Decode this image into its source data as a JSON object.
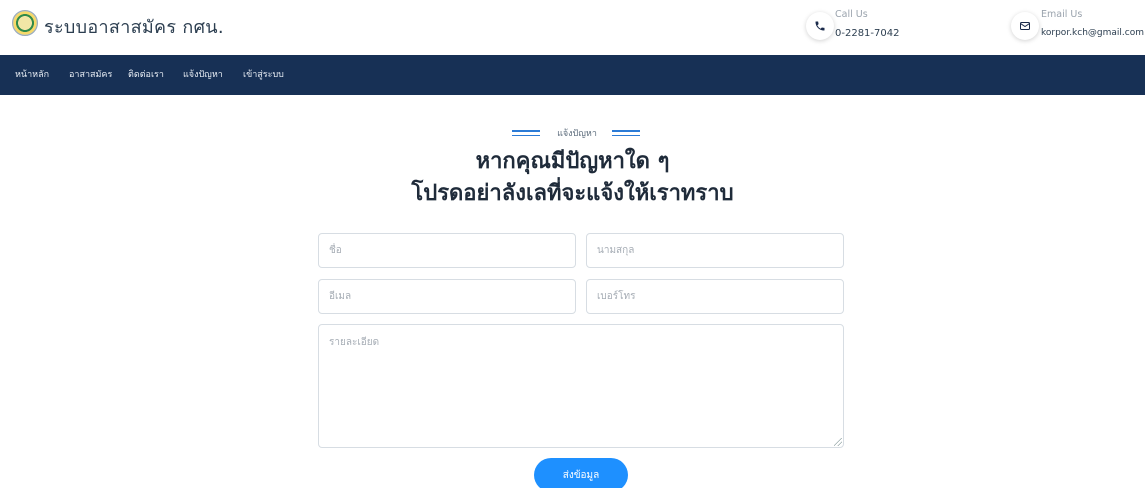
{
  "header": {
    "logo_text": "ระบบอาสาสมัคร กศน.",
    "phone": {
      "label": "Call Us",
      "value": "0-2281-7042",
      "icon": "phone-icon"
    },
    "email": {
      "label": "Email Us",
      "value": "korpor.kch@gmail.com",
      "icon": "mail-icon"
    }
  },
  "nav": {
    "items": [
      {
        "label": "หน้าหลัก"
      },
      {
        "label": "อาสาสมัคร"
      },
      {
        "label": "ติดต่อเรา"
      },
      {
        "label": "แจ้งปัญหา"
      },
      {
        "label": "เข้าสู่ระบบ"
      }
    ]
  },
  "section": {
    "tag": "แจ้งปัญหา",
    "heading_line1": "หากคุณมีปัญหาใด ๆ",
    "heading_line2": "โปรดอย่าลังเลที่จะแจ้งให้เราทราบ"
  },
  "form": {
    "first_name": {
      "placeholder": "ชื่อ",
      "value": ""
    },
    "last_name": {
      "placeholder": "นามสกุล",
      "value": ""
    },
    "email": {
      "placeholder": "อีเมล",
      "value": ""
    },
    "phone": {
      "placeholder": "เบอร์โทร",
      "value": ""
    },
    "details": {
      "placeholder": "รายละเอียด",
      "value": ""
    },
    "submit_label": "ส่งข้อมูล"
  },
  "colors": {
    "navbar": "#173055",
    "accent": "#1e90ff",
    "tag_lines": "#2b7bd6"
  }
}
